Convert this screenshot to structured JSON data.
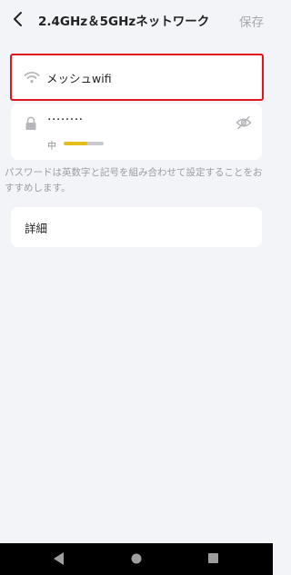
{
  "header": {
    "title": "2.4GHz＆5GHzネットワーク",
    "save_label": "保存",
    "back_icon": "chevron-left-icon"
  },
  "ssid": {
    "value": "メッシュwifi",
    "icon": "wifi-icon",
    "highlight_color": "#e0151b"
  },
  "password": {
    "value": "········",
    "icon": "lock-icon",
    "visibility_icon": "eye-off-icon",
    "strength_label": "中",
    "strength_fraction": 0.6,
    "strength_color": "#e3be1b"
  },
  "hint": "パスワードは英数字と記号を組み合わせて設定することをおすすめします。",
  "details": {
    "label": "詳細"
  },
  "system_nav": {
    "back_icon": "triangle-back-icon",
    "home_icon": "circle-home-icon",
    "recent_icon": "square-recent-icon"
  }
}
